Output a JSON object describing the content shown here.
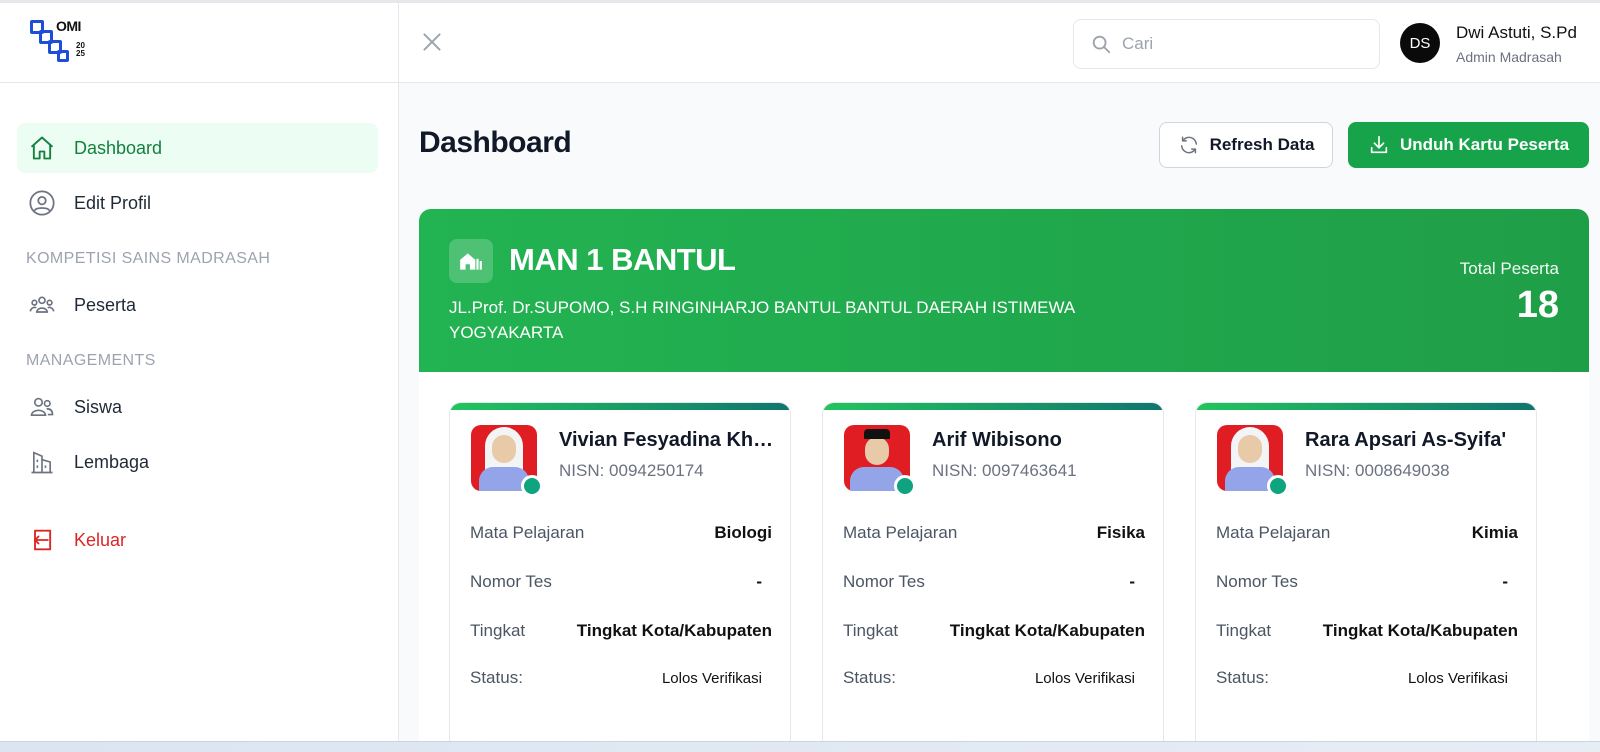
{
  "header": {
    "search_placeholder": "Cari",
    "user": {
      "initials": "DS",
      "name": "Dwi Astuti, S.Pd",
      "role": "Admin Madrasah"
    }
  },
  "logo": {
    "text": "OMI",
    "year_top": "20",
    "year_bottom": "25"
  },
  "sidebar": {
    "items": [
      {
        "label": "Dashboard",
        "icon": "home-icon",
        "active": true
      },
      {
        "label": "Edit Profil",
        "icon": "user-circle-icon"
      }
    ],
    "sections": [
      {
        "label": "KOMPETISI SAINS MADRASAH",
        "items": [
          {
            "label": "Peserta",
            "icon": "users-group-icon"
          }
        ]
      },
      {
        "label": "MANAGEMENTS",
        "items": [
          {
            "label": "Siswa",
            "icon": "users-icon"
          },
          {
            "label": "Lembaga",
            "icon": "building-icon"
          }
        ]
      }
    ],
    "logout": {
      "label": "Keluar",
      "icon": "logout-icon"
    }
  },
  "main": {
    "title": "Dashboard",
    "refresh_label": "Refresh Data",
    "download_label": "Unduh Kartu Peserta",
    "school": {
      "name": "MAN 1 BANTUL",
      "address": "JL.Prof. Dr.SUPOMO, S.H RINGINHARJO BANTUL BANTUL DAERAH ISTIMEWA YOGYAKARTA",
      "total_label": "Total Peserta",
      "total_value": "18"
    },
    "field_labels": {
      "subject": "Mata Pelajaran",
      "test_no": "Nomor Tes",
      "level": "Tingkat",
      "status": "Status:"
    },
    "students": [
      {
        "name": "Vivian Fesyadina Khairunnisa",
        "nisn": "NISN: 0094250174",
        "subject": "Biologi",
        "test_no": "-",
        "level": "Tingkat Kota/Kabupaten",
        "status": "Lolos Verifikasi"
      },
      {
        "name": "Arif Wibisono",
        "nisn": "NISN: 0097463641",
        "subject": "Fisika",
        "test_no": "-",
        "level": "Tingkat Kota/Kabupaten",
        "status": "Lolos Verifikasi"
      },
      {
        "name": "Rara Apsari As-Syifa'",
        "nisn": "NISN: 0008649038",
        "subject": "Kimia",
        "test_no": "-",
        "level": "Tingkat Kota/Kabupaten",
        "status": "Lolos Verifikasi"
      }
    ]
  },
  "colors": {
    "brand_green": "#16a34a",
    "active_bg": "#ecfdf3",
    "logout_red": "#dc2626",
    "online_dot": "#10a37f"
  }
}
